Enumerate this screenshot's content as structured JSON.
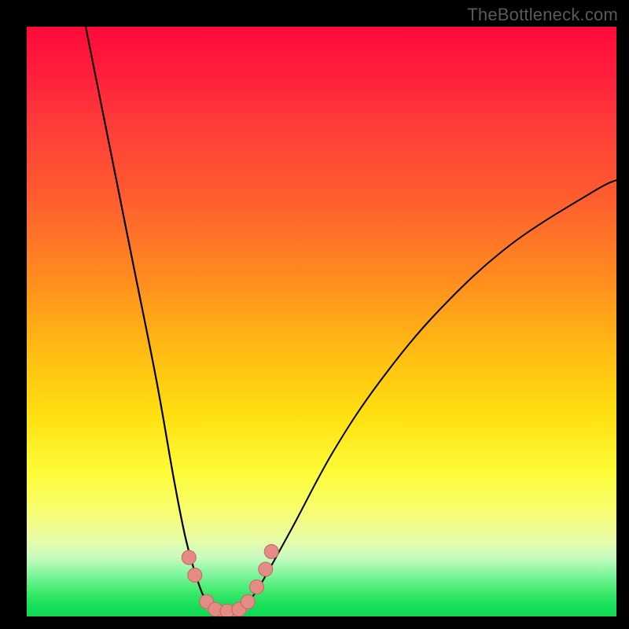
{
  "watermark": {
    "text": "TheBottleneck.com"
  },
  "colors": {
    "frame": "#000000",
    "curve": "#000000",
    "marker_fill": "#e58b85",
    "marker_stroke": "#c4675f"
  },
  "chart_data": {
    "type": "line",
    "title": "",
    "xlabel": "",
    "ylabel": "",
    "xlim": [
      0,
      100
    ],
    "ylim": [
      0,
      100
    ],
    "grid": false,
    "legend": false,
    "description": "Bottleneck severity curve over a red→green gradient. Y≈100 = worst (red), Y≈0 = best (green). Minimum (optimal balance) near x≈33.",
    "series": [
      {
        "name": "left-branch",
        "x": [
          10,
          14,
          18,
          22,
          25,
          27,
          29,
          30.5,
          32
        ],
        "y": [
          100,
          80,
          60,
          40,
          23,
          13,
          6,
          2.5,
          1
        ]
      },
      {
        "name": "right-branch",
        "x": [
          36,
          38,
          40,
          45,
          52,
          60,
          70,
          82,
          96,
          100
        ],
        "y": [
          1,
          3,
          6,
          15,
          28,
          40,
          52,
          63,
          72,
          74
        ]
      },
      {
        "name": "valley-floor",
        "x": [
          30.5,
          32,
          34,
          36,
          37.5
        ],
        "y": [
          2.5,
          1,
          0.8,
          1,
          2.5
        ]
      }
    ],
    "markers": [
      {
        "x": 27.5,
        "y": 10
      },
      {
        "x": 28.5,
        "y": 7
      },
      {
        "x": 30.5,
        "y": 2.5
      },
      {
        "x": 32,
        "y": 1.2
      },
      {
        "x": 34,
        "y": 0.9
      },
      {
        "x": 36,
        "y": 1.2
      },
      {
        "x": 37.5,
        "y": 2.5
      },
      {
        "x": 39,
        "y": 5
      },
      {
        "x": 40.5,
        "y": 8
      },
      {
        "x": 41.5,
        "y": 11
      }
    ]
  }
}
